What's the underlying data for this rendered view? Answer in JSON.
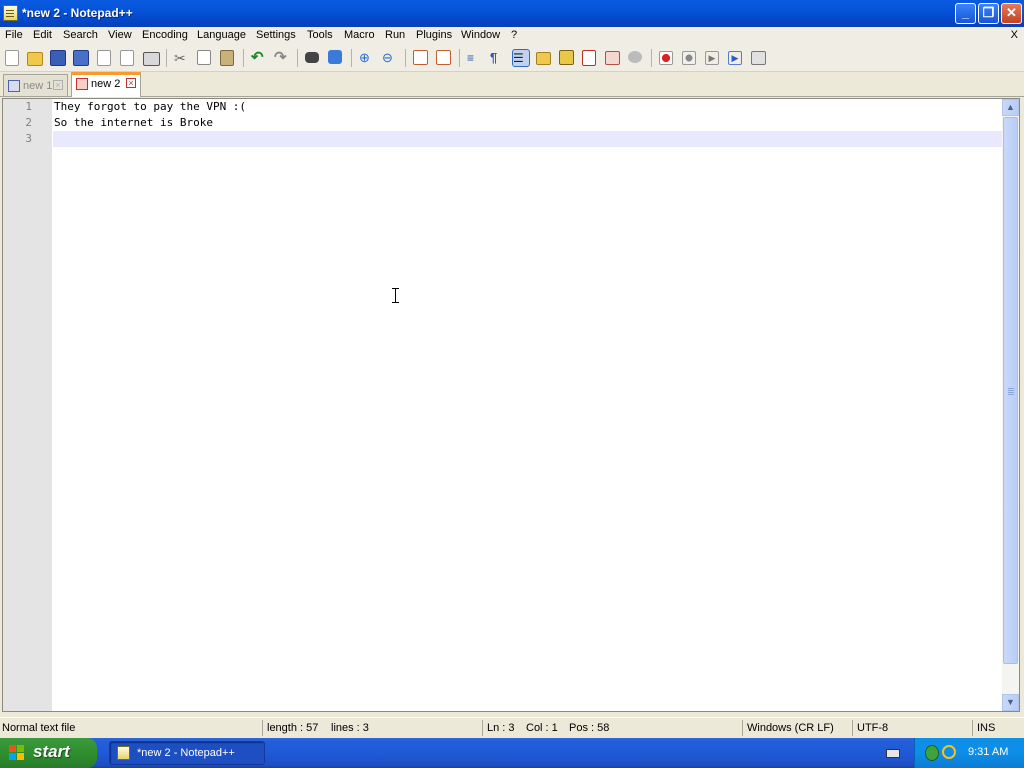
{
  "window": {
    "title": "*new 2 - Notepad++",
    "minimize_icon": "minimize-icon",
    "maximize_icon": "restore-icon",
    "close_icon": "close-icon",
    "minimize_glyph": "_",
    "restore_glyph": "❐",
    "close_glyph": "✕"
  },
  "menu": {
    "items": [
      "File",
      "Edit",
      "Search",
      "View",
      "Encoding",
      "Language",
      "Settings",
      "Tools",
      "Macro",
      "Run",
      "Plugins",
      "Window",
      "?"
    ],
    "close_doc": "X"
  },
  "toolbar": {
    "buttons": [
      "new-file",
      "open-file",
      "save",
      "save-all",
      "close",
      "close-all",
      "print",
      "cut",
      "copy",
      "paste",
      "undo",
      "redo",
      "find",
      "replace",
      "zoom-in",
      "zoom-out",
      "sync-vertical",
      "sync-horizontal",
      "word-wrap",
      "show-all-characters",
      "indent-guide",
      "user-defined-language",
      "function-list",
      "doc-map",
      "folder-as-workspace",
      "macro-record",
      "macro-stop",
      "macro-playback",
      "macro-run-multiple",
      "macro-save"
    ]
  },
  "tabs": [
    {
      "label": "new 1",
      "active": false
    },
    {
      "label": "new 2",
      "active": true
    }
  ],
  "editor": {
    "line_numbers": [
      "1",
      "2",
      "3"
    ],
    "lines": [
      "They forgot to pay the VPN :(",
      "So the internet is Broke",
      ""
    ],
    "current_line": 3
  },
  "statusbar": {
    "file_type": "Normal text file",
    "length": "length : 57",
    "lines": "lines : 3",
    "ln": "Ln : 3",
    "col": "Col : 1",
    "pos": "Pos : 58",
    "eol": "Windows (CR LF)",
    "encoding": "UTF-8",
    "mode": "INS"
  },
  "taskbar": {
    "start_label": "start",
    "window_button": "*new 2 - Notepad++",
    "clock": "9:31 AM"
  },
  "colors": {
    "title_blue": "#0552d8",
    "tab_accent": "#fa9a2a",
    "current_line": "#e8e8ff",
    "start_green": "#2f8f2f"
  }
}
